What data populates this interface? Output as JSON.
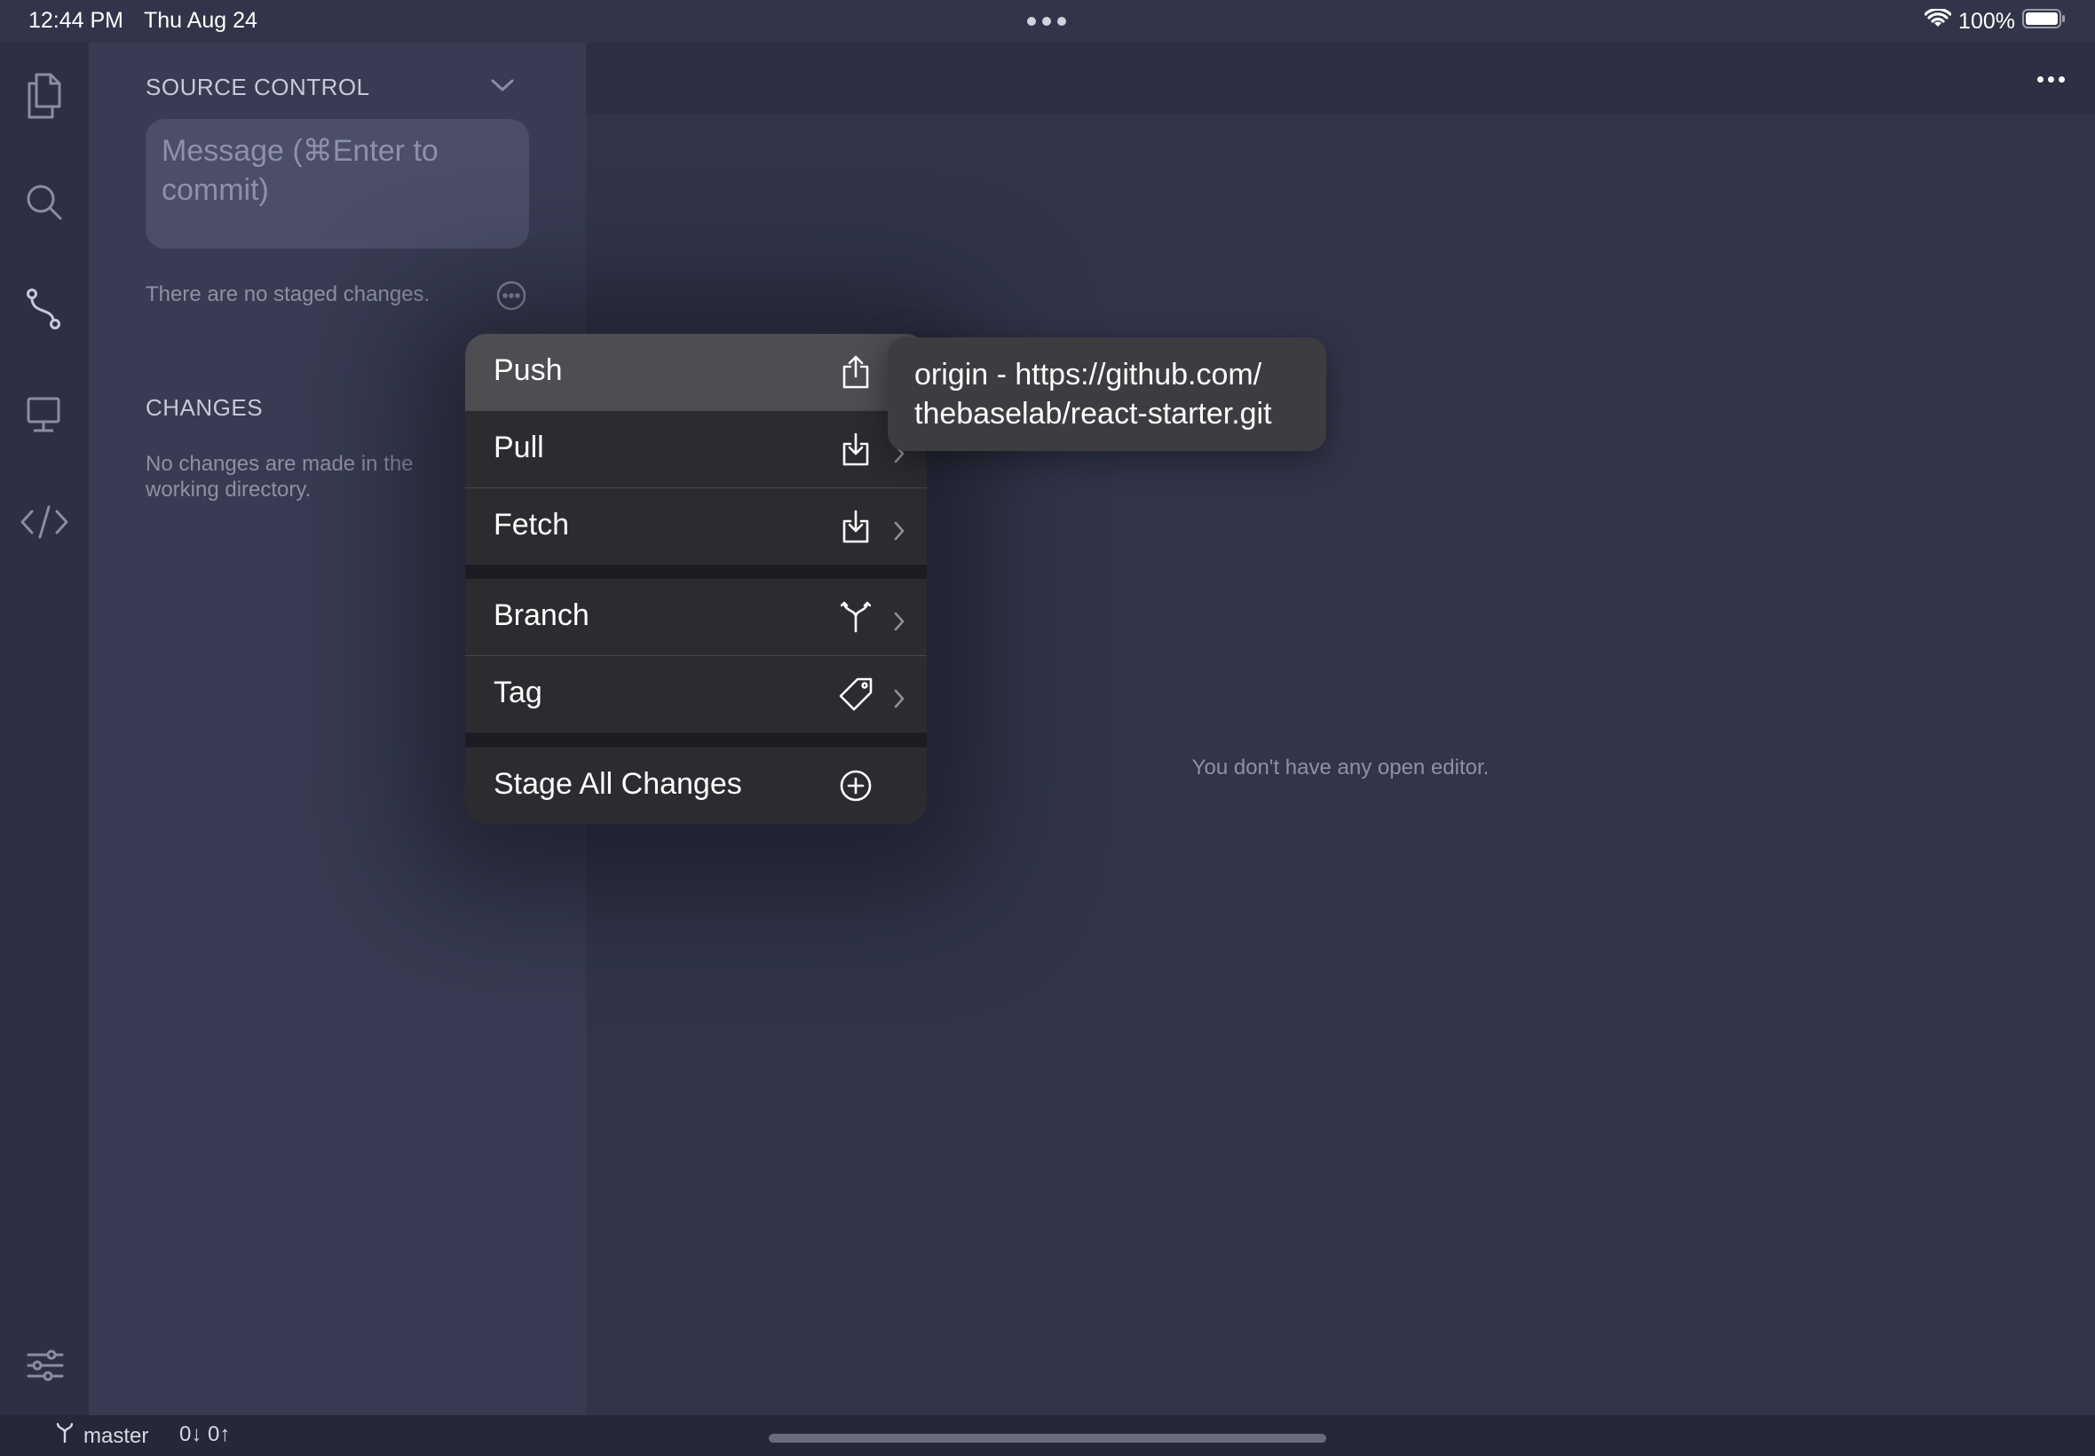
{
  "status_bar": {
    "time": "12:44 PM",
    "date": "Thu Aug 24",
    "battery": "100%"
  },
  "sidebar": {
    "title": "SOURCE CONTROL",
    "commit_placeholder": "Message (⌘Enter to commit)",
    "staged_empty": "There are no staged changes.",
    "changes_title": "CHANGES",
    "changes_empty": "No changes are made in the working directory."
  },
  "activity_bar": {
    "items": [
      "files-icon",
      "search-icon",
      "source-control-icon",
      "remote-icon",
      "code-icon"
    ],
    "active": "source-control-icon"
  },
  "editor": {
    "empty_text": "You don't have any open editor."
  },
  "context_menu": {
    "items": [
      {
        "label": "Push",
        "icon": "share-up-icon",
        "has_submenu": true
      },
      {
        "label": "Pull",
        "icon": "download-icon",
        "has_submenu": true
      },
      {
        "label": "Fetch",
        "icon": "download-icon",
        "has_submenu": true
      },
      {
        "label": "Branch",
        "icon": "branch-icon",
        "has_submenu": true
      },
      {
        "label": "Tag",
        "icon": "tag-icon",
        "has_submenu": true
      },
      {
        "label": "Stage All Changes",
        "icon": "plus-circle-icon",
        "has_submenu": false
      }
    ],
    "highlighted": "Push"
  },
  "submenu": {
    "line1": "origin - https://github.com/",
    "line2": "thebaselab/react-starter.git"
  },
  "bottom_bar": {
    "branch": "master",
    "sync": "0↓ 0↑"
  },
  "colors": {
    "background": "#323549",
    "sidebar": "#383b51",
    "activity_bar": "#2d3043",
    "menu_item": "#2c2c30",
    "menu_highlight": "#4d4d52",
    "accent": "#c6c9d9"
  }
}
